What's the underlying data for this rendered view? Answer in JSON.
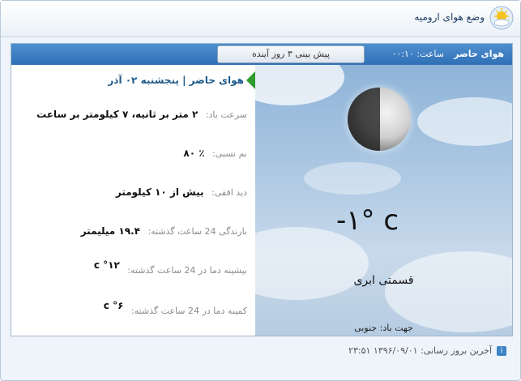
{
  "header": {
    "title": "وضع هوای ارومیه",
    "icon": "sun-cloud-icon"
  },
  "tabs": {
    "current": "هوای حاضر",
    "time_label": "ساعت: ۰۰:۱۰",
    "forecast_button": "پیش بینی ۳ روز آینده"
  },
  "current": {
    "day_line": "هوای حاضر | پنجشنبه ۰۲ آذر",
    "wind_speed_label": "سرعت باد:",
    "wind_speed_value": "۲ متر بر ثانیه، ۷ کیلومتر بر ساعت",
    "humidity_label": "نم نسبی:",
    "humidity_value": "٪ ۸۰",
    "visibility_label": "دید افقی:",
    "visibility_value": "بیش از ۱۰ کیلومتر",
    "rain_label": "بارندگی 24 ساعت گذشته:",
    "rain_value": "۱۹.۴ میلیمتر",
    "max_label": "بیشینه دما در 24 ساعت گذشته:",
    "max_value": "۱۲° c",
    "min_label": "کمینه دما در 24 ساعت گذشته:",
    "min_value": "۶° c",
    "temperature": "-۱° c",
    "condition": "قسمتی ابری",
    "wind_direction": "جهت باد: جنوبی"
  },
  "footer": {
    "last_update": "آخرین بروز رسانی: ۱۳۹۶/۰۹/۰۱ ۲۳:۵۱"
  },
  "colors": {
    "tab_bar": "#2f6fb5",
    "accent_arrow": "#2f9a2f"
  }
}
